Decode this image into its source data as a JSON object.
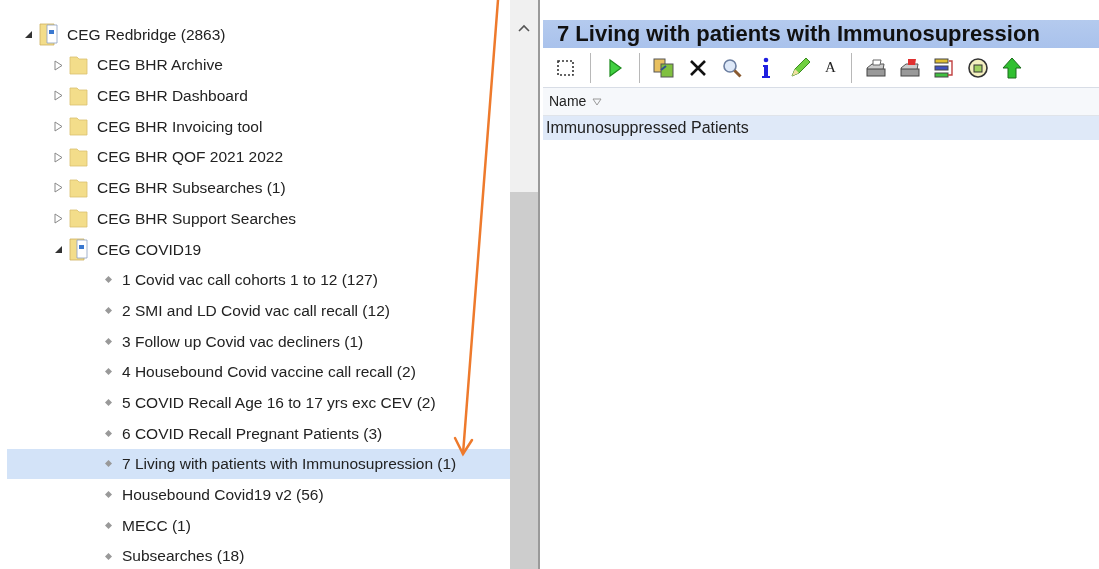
{
  "tree": [
    {
      "label": "CEG Redbridge (2863)",
      "kind": "report",
      "expanded": true,
      "selected": false,
      "children": [
        {
          "label": "CEG BHR Archive",
          "kind": "folder",
          "expanded": false,
          "selected": false
        },
        {
          "label": "CEG BHR Dashboard",
          "kind": "folder",
          "expanded": false,
          "selected": false
        },
        {
          "label": "CEG BHR Invoicing tool",
          "kind": "folder",
          "expanded": false,
          "selected": false
        },
        {
          "label": "CEG BHR QOF 2021 2022",
          "kind": "folder",
          "expanded": false,
          "selected": false
        },
        {
          "label": "CEG BHR Subsearches (1)",
          "kind": "folder",
          "expanded": false,
          "selected": false
        },
        {
          "label": "CEG BHR Support Searches",
          "kind": "folder",
          "expanded": false,
          "selected": false
        },
        {
          "label": "CEG COVID19",
          "kind": "report",
          "expanded": true,
          "selected": false,
          "children": [
            {
              "label": "1 Covid vac call cohorts 1 to 12 (127)",
              "kind": "search",
              "selected": false
            },
            {
              "label": "2 SMI and LD Covid vac call recall (12)",
              "kind": "search",
              "selected": false
            },
            {
              "label": "3 Follow up Covid vac decliners (1)",
              "kind": "search",
              "selected": false
            },
            {
              "label": "4 Housebound Covid vaccine call recall (2)",
              "kind": "search",
              "selected": false
            },
            {
              "label": "5 COVID Recall Age 16 to 17 yrs exc CEV (2)",
              "kind": "search",
              "selected": false
            },
            {
              "label": "6 COVID Recall Pregnant Patients (3)",
              "kind": "search",
              "selected": false
            },
            {
              "label": "7 Living with patients with Immunosupression (1)",
              "kind": "search",
              "selected": true
            },
            {
              "label": "Housebound Covid19 v2 (56)",
              "kind": "search",
              "selected": false
            },
            {
              "label": "MECC (1)",
              "kind": "search",
              "selected": false
            },
            {
              "label": "Subsearches (18)",
              "kind": "search",
              "selected": false
            }
          ]
        }
      ]
    }
  ],
  "panel": {
    "title": "7 Living with patients with Immunosupression",
    "toolbar": [
      {
        "kind": "select"
      },
      {
        "kind": "sep"
      },
      {
        "kind": "run"
      },
      {
        "kind": "sep"
      },
      {
        "kind": "copy"
      },
      {
        "kind": "delete"
      },
      {
        "kind": "search"
      },
      {
        "kind": "info"
      },
      {
        "kind": "edit"
      },
      {
        "kind": "font",
        "label": "A"
      },
      {
        "kind": "sep"
      },
      {
        "kind": "print"
      },
      {
        "kind": "print-red"
      },
      {
        "kind": "list"
      },
      {
        "kind": "badge"
      },
      {
        "kind": "up"
      }
    ],
    "columns": [
      "Name"
    ],
    "rows": [
      {
        "name": "Immunosuppressed Patients",
        "selected": true
      }
    ]
  }
}
